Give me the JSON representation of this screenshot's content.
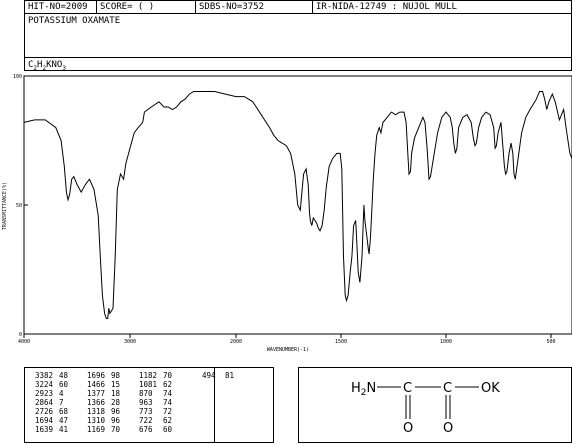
{
  "header": {
    "hit_no": "HIT-NO=2009",
    "score": "SCORE=  (   )",
    "sdbs_no": "SDBS-NO=3752",
    "ir_nida": "IR-NIDA-12749 : NUJOL MULL",
    "compound_name": "POTASSIUM OXAMATE",
    "formula": {
      "c": "C",
      "c_n": "2",
      "h": "H",
      "h_n": "2",
      "rest": "KNO",
      "o_n": "3"
    }
  },
  "chart_data": {
    "type": "line",
    "title": "",
    "xlabel": "WAVENUMBER(-1)",
    "ylabel": "TRANSMITTANCE(%)",
    "xlim": [
      4000,
      400
    ],
    "ylim": [
      0,
      100
    ],
    "x_ticks": [
      "4000",
      "3000",
      "2000",
      "1500",
      "1000",
      "500"
    ],
    "y_ticks": [
      "100",
      "50",
      "0"
    ],
    "grid": false,
    "series": [
      {
        "name": "",
        "points": [
          [
            4000,
            82
          ],
          [
            3900,
            83
          ],
          [
            3800,
            83
          ],
          [
            3700,
            80
          ],
          [
            3650,
            75
          ],
          [
            3620,
            65
          ],
          [
            3600,
            55
          ],
          [
            3585,
            52
          ],
          [
            3570,
            54
          ],
          [
            3550,
            60
          ],
          [
            3530,
            61
          ],
          [
            3500,
            58
          ],
          [
            3460,
            55
          ],
          [
            3420,
            58
          ],
          [
            3382,
            60
          ],
          [
            3340,
            56
          ],
          [
            3300,
            46
          ],
          [
            3280,
            30
          ],
          [
            3260,
            15
          ],
          [
            3240,
            8
          ],
          [
            3224,
            6
          ],
          [
            3210,
            6
          ],
          [
            3200,
            10
          ],
          [
            3190,
            8
          ],
          [
            3160,
            10
          ],
          [
            3140,
            30
          ],
          [
            3120,
            56
          ],
          [
            3090,
            62
          ],
          [
            3060,
            60
          ],
          [
            3040,
            66
          ],
          [
            3000,
            72
          ],
          [
            2960,
            78
          ],
          [
            2923,
            80
          ],
          [
            2880,
            82
          ],
          [
            2864,
            86
          ],
          [
            2800,
            88
          ],
          [
            2726,
            90
          ],
          [
            2680,
            88
          ],
          [
            2640,
            88
          ],
          [
            2600,
            87
          ],
          [
            2560,
            88
          ],
          [
            2520,
            90
          ],
          [
            2480,
            91
          ],
          [
            2440,
            93
          ],
          [
            2400,
            94
          ],
          [
            2300,
            94
          ],
          [
            2200,
            94
          ],
          [
            2100,
            93
          ],
          [
            2000,
            92
          ],
          [
            1960,
            92
          ],
          [
            1920,
            90
          ],
          [
            1880,
            85
          ],
          [
            1840,
            80
          ],
          [
            1820,
            77
          ],
          [
            1800,
            75
          ],
          [
            1760,
            73
          ],
          [
            1740,
            70
          ],
          [
            1720,
            62
          ],
          [
            1706,
            50
          ],
          [
            1694,
            48
          ],
          [
            1686,
            55
          ],
          [
            1678,
            62
          ],
          [
            1666,
            64
          ],
          [
            1656,
            58
          ],
          [
            1650,
            47
          ],
          [
            1646,
            44
          ],
          [
            1639,
            42
          ],
          [
            1632,
            45
          ],
          [
            1624,
            44
          ],
          [
            1616,
            43
          ],
          [
            1608,
            41
          ],
          [
            1600,
            40
          ],
          [
            1590,
            42
          ],
          [
            1580,
            48
          ],
          [
            1570,
            57
          ],
          [
            1556,
            65
          ],
          [
            1540,
            68
          ],
          [
            1520,
            70
          ],
          [
            1504,
            70
          ],
          [
            1496,
            64
          ],
          [
            1488,
            30
          ],
          [
            1480,
            15
          ],
          [
            1474,
            13
          ],
          [
            1466,
            15
          ],
          [
            1456,
            24
          ],
          [
            1448,
            30
          ],
          [
            1440,
            42
          ],
          [
            1430,
            44
          ],
          [
            1424,
            34
          ],
          [
            1418,
            24
          ],
          [
            1410,
            20
          ],
          [
            1400,
            30
          ],
          [
            1391,
            50
          ],
          [
            1386,
            44
          ],
          [
            1377,
            38
          ],
          [
            1370,
            33
          ],
          [
            1366,
            31
          ],
          [
            1360,
            37
          ],
          [
            1354,
            47
          ],
          [
            1346,
            60
          ],
          [
            1338,
            70
          ],
          [
            1330,
            77
          ],
          [
            1318,
            80
          ],
          [
            1310,
            78
          ],
          [
            1300,
            82
          ],
          [
            1280,
            84
          ],
          [
            1260,
            86
          ],
          [
            1240,
            85
          ],
          [
            1220,
            86
          ],
          [
            1200,
            86
          ],
          [
            1190,
            82
          ],
          [
            1182,
            70
          ],
          [
            1176,
            62
          ],
          [
            1169,
            63
          ],
          [
            1164,
            70
          ],
          [
            1150,
            76
          ],
          [
            1130,
            80
          ],
          [
            1110,
            84
          ],
          [
            1100,
            82
          ],
          [
            1090,
            72
          ],
          [
            1081,
            60
          ],
          [
            1074,
            61
          ],
          [
            1060,
            68
          ],
          [
            1040,
            78
          ],
          [
            1020,
            84
          ],
          [
            1000,
            86
          ],
          [
            980,
            84
          ],
          [
            970,
            80
          ],
          [
            963,
            74
          ],
          [
            955,
            70
          ],
          [
            948,
            72
          ],
          [
            940,
            80
          ],
          [
            920,
            84
          ],
          [
            900,
            85
          ],
          [
            880,
            82
          ],
          [
            870,
            76
          ],
          [
            862,
            73
          ],
          [
            855,
            74
          ],
          [
            845,
            80
          ],
          [
            830,
            84
          ],
          [
            810,
            86
          ],
          [
            790,
            85
          ],
          [
            773,
            80
          ],
          [
            766,
            72
          ],
          [
            760,
            73
          ],
          [
            752,
            78
          ],
          [
            738,
            82
          ],
          [
            722,
            65
          ],
          [
            716,
            62
          ],
          [
            710,
            63
          ],
          [
            700,
            70
          ],
          [
            690,
            74
          ],
          [
            682,
            70
          ],
          [
            676,
            62
          ],
          [
            670,
            60
          ],
          [
            660,
            66
          ],
          [
            640,
            78
          ],
          [
            620,
            84
          ],
          [
            600,
            87
          ],
          [
            585,
            89
          ],
          [
            570,
            91
          ],
          [
            555,
            94
          ],
          [
            540,
            94
          ],
          [
            530,
            91
          ],
          [
            520,
            87
          ],
          [
            510,
            90
          ],
          [
            494,
            93
          ],
          [
            480,
            90
          ],
          [
            460,
            83
          ],
          [
            440,
            87
          ],
          [
            425,
            78
          ],
          [
            410,
            70
          ],
          [
            400,
            68
          ]
        ]
      }
    ]
  },
  "peak_table": {
    "columns": [
      {
        "wn": [
          "3382",
          "3224",
          "2923",
          "2864",
          "2726",
          "1694",
          "1639"
        ],
        "t": [
          "48",
          "60",
          "4",
          "7",
          "68",
          "47",
          "41"
        ]
      },
      {
        "wn": [
          "1696",
          "1466",
          "1377",
          "1366",
          "1318",
          "1310",
          "1169"
        ],
        "t": [
          "98",
          "15",
          "18",
          "28",
          "96",
          "96",
          "70"
        ]
      },
      {
        "wn": [
          "1182",
          "1081",
          "870",
          "963",
          "773",
          "722",
          "676"
        ],
        "t": [
          "70",
          "62",
          "74",
          "74",
          "72",
          "62",
          "60"
        ]
      },
      {
        "wn": [
          "494"
        ],
        "t": [
          "81"
        ]
      }
    ]
  },
  "structure": {
    "h2n": "H2N",
    "c1": "C",
    "c2": "C",
    "ok": "OK",
    "o1": "O",
    "o2": "O"
  }
}
